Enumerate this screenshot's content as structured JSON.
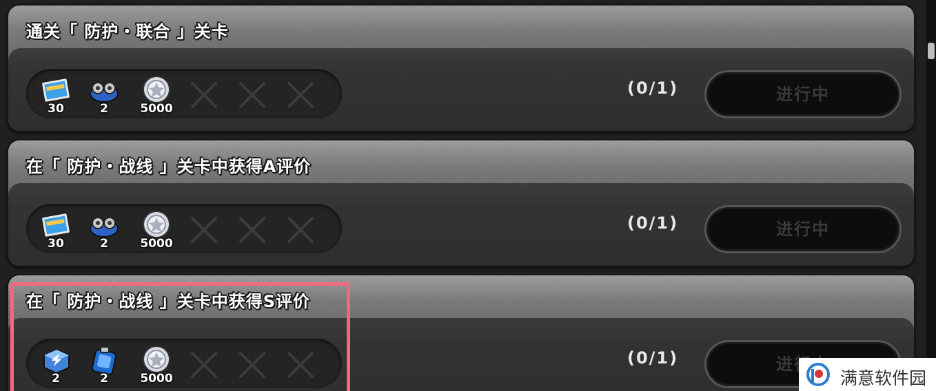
{
  "colors": {
    "highlight": "#f06a7c",
    "status_text": "#3a3a3a",
    "panel": "#2b2b2b"
  },
  "quests": [
    {
      "title": "通关「 防护・联合 」关卡",
      "progress": "(0/1)",
      "status": "进行中",
      "rewards": [
        {
          "icon": "film-ticket-icon",
          "qty": "30"
        },
        {
          "icon": "gear-parts-icon",
          "qty": "2"
        },
        {
          "icon": "silver-coin-icon",
          "qty": "5000"
        }
      ]
    },
    {
      "title": "在「 防护・战线 」关卡中获得A评价",
      "progress": "(0/1)",
      "status": "进行中",
      "rewards": [
        {
          "icon": "film-ticket-icon",
          "qty": "30"
        },
        {
          "icon": "gear-parts-icon",
          "qty": "2"
        },
        {
          "icon": "silver-coin-icon",
          "qty": "5000"
        }
      ]
    },
    {
      "title": "在「 防护・战线 」关卡中获得S评价",
      "progress": "(0/1)",
      "status": "进行中",
      "rewards": [
        {
          "icon": "blue-cube-icon",
          "qty": "2"
        },
        {
          "icon": "blue-tank-icon",
          "qty": "2"
        },
        {
          "icon": "silver-coin-icon",
          "qty": "5000"
        }
      ]
    }
  ],
  "watermark": {
    "text": "满意软件园"
  }
}
